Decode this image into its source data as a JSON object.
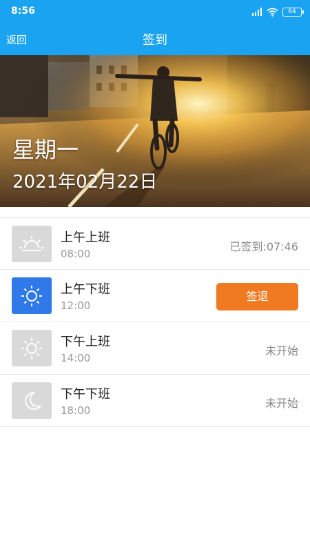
{
  "status_bar": {
    "time": "8:56",
    "battery": "64"
  },
  "nav": {
    "back": "返回",
    "title": "签到"
  },
  "hero": {
    "weekday": "星期一",
    "date": "2021年02月22日"
  },
  "colors": {
    "header": "#1aa3f0",
    "active_icon": "#2f79e8",
    "action_button": "#f07a1f"
  },
  "items": [
    {
      "label": "上午上班",
      "time": "08:00",
      "icon": "sunrise-icon",
      "status": "已签到:07:46"
    },
    {
      "label": "上午下班",
      "time": "12:00",
      "icon": "sun-icon",
      "button": "签退"
    },
    {
      "label": "下午上班",
      "time": "14:00",
      "icon": "sun-icon",
      "status": "未开始"
    },
    {
      "label": "下午下班",
      "time": "18:00",
      "icon": "moon-icon",
      "status": "未开始"
    }
  ]
}
